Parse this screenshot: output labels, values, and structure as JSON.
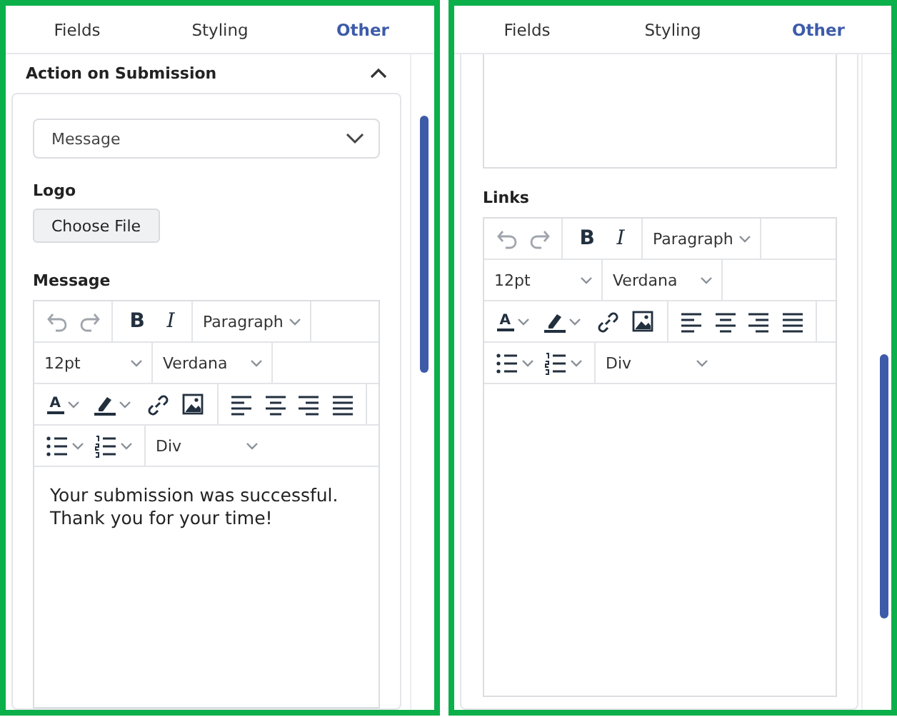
{
  "panels": [
    {
      "kind": "action",
      "tabs": [
        {
          "label": "Fields",
          "selected": false
        },
        {
          "label": "Styling",
          "selected": false
        },
        {
          "label": "Other",
          "selected": true
        }
      ],
      "section": {
        "title": "Action on Submission",
        "expanded": true
      },
      "action_select": {
        "value": "Message"
      },
      "logo": {
        "label": "Logo",
        "button": "Choose File"
      },
      "editor_label": "Message",
      "editor": {
        "bold": "B",
        "italic": "I",
        "block_format": "Paragraph",
        "font_size": "12pt",
        "font_family": "Verdana",
        "text_color": "A",
        "container": "Div",
        "content": [
          "Your submission was successful.",
          "Thank you for your time!"
        ]
      }
    },
    {
      "kind": "links",
      "tabs": [
        {
          "label": "Fields",
          "selected": false
        },
        {
          "label": "Styling",
          "selected": false
        },
        {
          "label": "Other",
          "selected": true
        }
      ],
      "editor_label": "Links",
      "editor": {
        "bold": "B",
        "italic": "I",
        "block_format": "Paragraph",
        "font_size": "12pt",
        "font_family": "Verdana",
        "text_color": "A",
        "container": "Div"
      }
    }
  ]
}
